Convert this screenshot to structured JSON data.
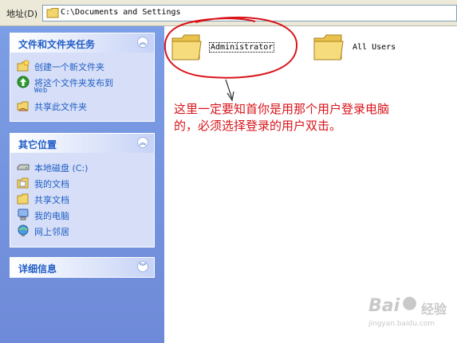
{
  "addressbar": {
    "label": "地址(D)",
    "path": "C:\\Documents and Settings"
  },
  "tasks_panel": {
    "title": "文件和文件夹任务",
    "items": [
      {
        "label": "创建一个新文件夹",
        "icon": "new-folder-icon"
      },
      {
        "label": "将这个文件夹发布到",
        "label2": "Web",
        "icon": "publish-web-icon"
      },
      {
        "label": "共享此文件夹",
        "icon": "share-folder-icon"
      }
    ]
  },
  "places_panel": {
    "title": "其它位置",
    "items": [
      {
        "label": "本地磁盘 (C:)",
        "icon": "local-disk-icon"
      },
      {
        "label": "我的文档",
        "icon": "my-documents-icon"
      },
      {
        "label": "共享文档",
        "icon": "shared-documents-icon"
      },
      {
        "label": "我的电脑",
        "icon": "my-computer-icon"
      },
      {
        "label": "网上邻居",
        "icon": "network-places-icon"
      }
    ]
  },
  "details_panel": {
    "title": "详细信息"
  },
  "folders": [
    {
      "name": "Administrator",
      "selected": true
    },
    {
      "name": "All Users",
      "selected": false
    }
  ],
  "annotation": {
    "line1": "这里一定要知首你是用那个用户登录电脑",
    "line2": "的，必须选择登录的用户双击。",
    "color": "#d9141a"
  },
  "watermark": {
    "brand": "Bai",
    "brand2": "经验",
    "url": "jingyan.baidu.com"
  },
  "colors": {
    "pane_blue": "#6e8ad8",
    "panel_bg": "#d6dff7",
    "link_blue": "#215dc6",
    "folder_yellow": "#f3d56d"
  }
}
